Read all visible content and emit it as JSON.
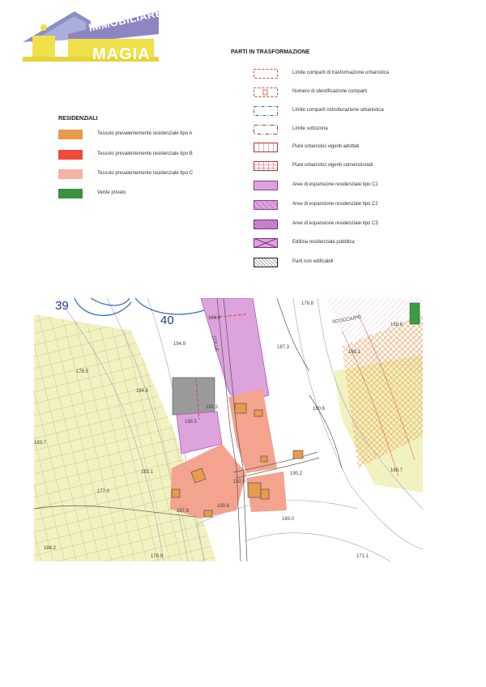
{
  "logo": {
    "line1": "IMMOBILIARE",
    "line2": "MAGIA"
  },
  "residenziali": {
    "title": "RESIDENZIALI",
    "items": [
      {
        "label": "Tessuto prevalentemente residenziale tipo A",
        "color": "#e89a4e"
      },
      {
        "label": "Tessuto prevalentemente residenziale tipo B",
        "color": "#ef4a3c"
      },
      {
        "label": "Tessuto prevalentemente residenziale tipo C",
        "color": "#f6b2a2"
      },
      {
        "label": "Verde privato",
        "color": "#3f9a46"
      }
    ]
  },
  "trasformazione": {
    "title": "PARTI IN TRASFORMAZIONE",
    "items": [
      {
        "label": "Limite comparti di trasformazione urbanistica"
      },
      {
        "label": "Numero di identificazione comparti"
      },
      {
        "label": "Limite comparti ristrutturazione urbanistica"
      },
      {
        "label": "Limite sottozona"
      },
      {
        "label": "Piani urbanistici vigenti adottati"
      },
      {
        "label": "Piani urbanistici vigenti convenzionati"
      },
      {
        "label": "Aree di espansione residenziale tipo C1"
      },
      {
        "label": "Aree di espansione residenziale tipo C2"
      },
      {
        "label": "Aree di espansione residenziale tipo C3"
      },
      {
        "label": "Edilizia residenziale pubblica"
      },
      {
        "label": "Parti non edificabili"
      }
    ]
  },
  "map": {
    "sheet_left": "39",
    "sheet_right": "40",
    "road_label": "COLLE",
    "place_label": "SCOCCIUPO",
    "elevations": [
      "194.6",
      "194.9",
      "187.3",
      "178.8",
      "165.8",
      "178.5",
      "184.8",
      "192.2",
      "188.5",
      "180.6",
      "165.1",
      "183.7",
      "183.1",
      "177.0",
      "192.6",
      "190.2",
      "165.7",
      "187.8",
      "189.6",
      "189.0",
      "171.1",
      "184.2",
      "178.9"
    ],
    "colors": {
      "agricultural": "#f2f2c0",
      "grid": "#b7b48c",
      "tipoC": "#f3a38e",
      "c1": "#dca3dd",
      "grey": "#9a9a9a",
      "orange_hatch": "#e6a34a",
      "contour": "#3a6fb5"
    }
  }
}
